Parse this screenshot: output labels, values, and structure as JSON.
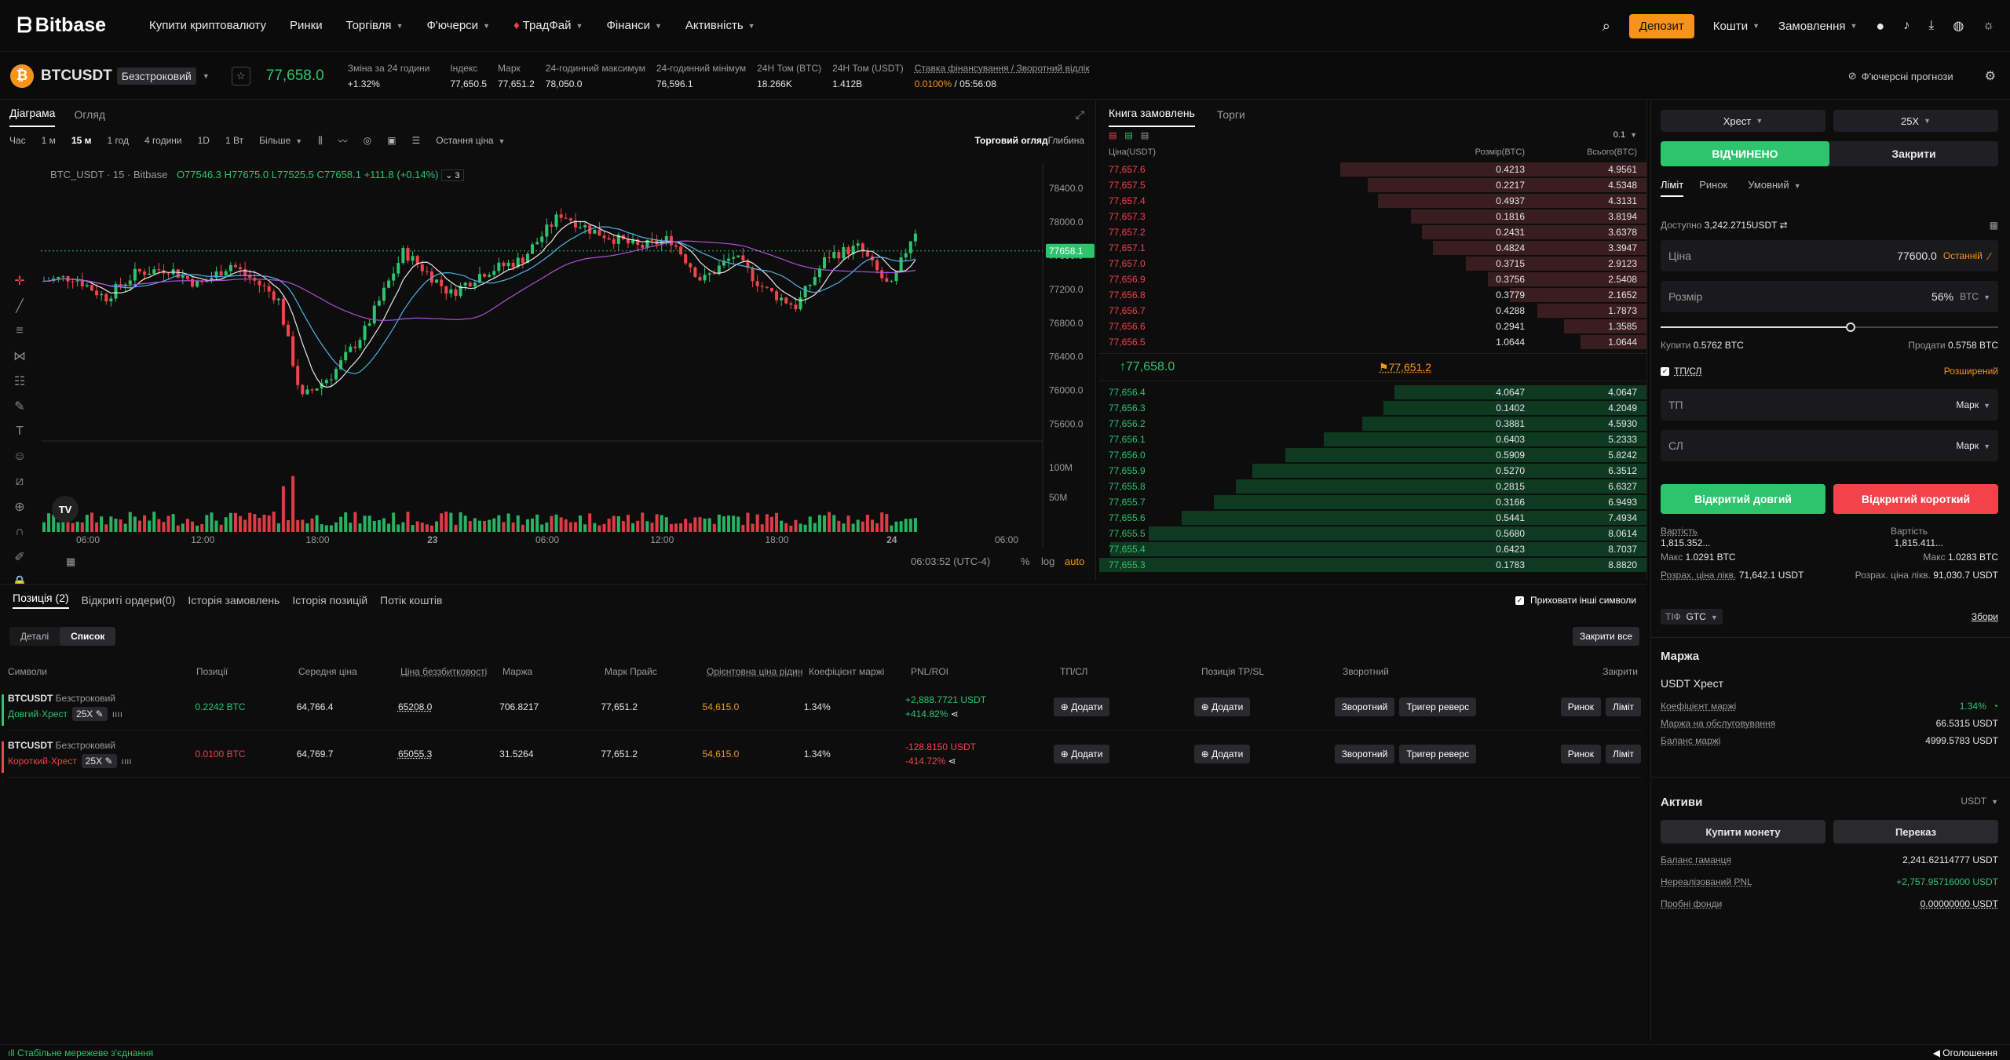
{
  "topnav": {
    "logo": "Bitbase",
    "items": [
      "Купити криптовалюту",
      "Ринки",
      "Торгівля",
      "Ф'ючерси",
      "ТрадФай",
      "Фінанси",
      "Активність"
    ],
    "deposit": "Депозит",
    "wallet": "Кошти",
    "orders": "Замовлення"
  },
  "ticker": {
    "symbol": "BTCUSDT",
    "type": "Безстроковий",
    "last_price": "77,658.0",
    "stats": [
      {
        "k": "Зміна за 24 години",
        "v": "+1.32%"
      },
      {
        "k": "Індекс",
        "v": "77,650.5"
      },
      {
        "k": "Марк",
        "v": "77,651.2"
      },
      {
        "k": "24-годинний максимум",
        "v": "78,050.0"
      },
      {
        "k": "24-годинний мінімум",
        "v": "76,596.1"
      },
      {
        "k": "24H Том (BTC)",
        "v": "18.266K"
      },
      {
        "k": "24H Том (USDT)",
        "v": "1.412B"
      }
    ],
    "funding_label": "Ставка фінансування / Зворотний відлік",
    "funding_rate": "0.0100%",
    "countdown": "05:56:08",
    "forecast": "Ф'ючерсні прогнози"
  },
  "chart_tabs": {
    "chart": "Діаграма",
    "overview": "Огляд"
  },
  "chart_toolbar": {
    "intervals": [
      "Час",
      "1 м",
      "15 м",
      "1 год",
      "4 години",
      "1D",
      "1 Вт",
      "Більше"
    ],
    "active": "15 м",
    "last_price": "Остання ціна",
    "trading_view": "Торговий огляд",
    "depth": "Глибина"
  },
  "chart_legend": {
    "title": "BTC_USDT · 15 · Bitbase",
    "o": "O77546.3",
    "h": "H77675.0",
    "l": "L77525.5",
    "c": "C77658.1",
    "chg": "+111.8 (+0.14%)",
    "indicators": "3"
  },
  "chart_data": {
    "type": "candlestick",
    "x_ticks": [
      "06:00",
      "12:00",
      "18:00",
      "23",
      "06:00",
      "12:00",
      "18:00",
      "24",
      "06:00"
    ],
    "y_ticks": [
      78400,
      78000,
      77600,
      77200,
      76800,
      76400,
      76000,
      75600
    ],
    "ylim": [
      75400,
      78700
    ],
    "last_label": "77658.1",
    "volume_ticks": [
      "100M",
      "50M"
    ]
  },
  "chart_footer": {
    "time": "06:03:52 (UTC-4)",
    "pct": "%",
    "log": "log",
    "auto": "auto"
  },
  "book": {
    "tabs": [
      "Книга замовлень",
      "Торги"
    ],
    "step": "0.1",
    "headers": [
      "Ціна(USDT)",
      "Розмір(BTC)",
      "Всього(BTC)"
    ],
    "asks": [
      [
        "77,657.6",
        "0.4213",
        "4.9561",
        0.56
      ],
      [
        "77,657.5",
        "0.2217",
        "4.5348",
        0.51
      ],
      [
        "77,657.4",
        "0.4937",
        "4.3131",
        0.49
      ],
      [
        "77,657.3",
        "0.1816",
        "3.8194",
        0.43
      ],
      [
        "77,657.2",
        "0.2431",
        "3.6378",
        0.41
      ],
      [
        "77,657.1",
        "0.4824",
        "3.3947",
        0.39
      ],
      [
        "77,657.0",
        "0.3715",
        "2.9123",
        0.33
      ],
      [
        "77,656.9",
        "0.3756",
        "2.5408",
        0.29
      ],
      [
        "77,656.8",
        "0.3779",
        "2.1652",
        0.25
      ],
      [
        "77,656.7",
        "0.4288",
        "1.7873",
        0.2
      ],
      [
        "77,656.6",
        "0.2941",
        "1.3585",
        0.15
      ],
      [
        "77,656.5",
        "1.0644",
        "1.0644",
        0.12
      ]
    ],
    "mid_price": "↑77,658.0",
    "mark_price": "77,651.2",
    "bids": [
      [
        "77,656.4",
        "4.0647",
        "4.0647",
        0.46
      ],
      [
        "77,656.3",
        "0.1402",
        "4.2049",
        0.48
      ],
      [
        "77,656.2",
        "0.3881",
        "4.5930",
        0.52
      ],
      [
        "77,656.1",
        "0.6403",
        "5.2333",
        0.59
      ],
      [
        "77,656.0",
        "0.5909",
        "5.8242",
        0.66
      ],
      [
        "77,655.9",
        "0.5270",
        "6.3512",
        0.72
      ],
      [
        "77,655.8",
        "0.2815",
        "6.6327",
        0.75
      ],
      [
        "77,655.7",
        "0.3166",
        "6.9493",
        0.79
      ],
      [
        "77,655.6",
        "0.5441",
        "7.4934",
        0.85
      ],
      [
        "77,655.5",
        "0.5680",
        "8.0614",
        0.91
      ],
      [
        "77,655.4",
        "0.6423",
        "8.7037",
        0.98
      ],
      [
        "77,655.3",
        "0.1783",
        "8.8820",
        1.0
      ]
    ]
  },
  "order": {
    "margin_mode": "Хрест",
    "leverage": "25X",
    "open": "ВІДЧИНЕНО",
    "close": "Закрити",
    "types": [
      "Ліміт",
      "Ринок",
      "Умовний"
    ],
    "available_label": "Доступно",
    "available": "3,242.2715USDT",
    "price_label": "Ціна",
    "price": "77600.0",
    "last_btn": "Останній",
    "size_label": "Розмір",
    "size_pct": "56%",
    "size_unit": "BTC",
    "buy_label": "Купити",
    "buy_amt": "0.5762 BTC",
    "sell_label": "Продати",
    "sell_amt": "0.5758 BTC",
    "tpsl": "ТП/СЛ",
    "advanced": "Розширений",
    "tp": "ТП",
    "sl": "СЛ",
    "mark": "Марк",
    "long_btn": "Відкритий довгий",
    "short_btn": "Відкритий короткий",
    "cost_label": "Вартість",
    "cost_l": "1,815.352...",
    "cost_r": "1,815.411...",
    "max_label": "Макс",
    "max_l": "1.0291 BTC",
    "max_r": "1.0283 BTC",
    "liq_label": "Розрах. ціна лікв.",
    "liq_l": "71,642.1 USDT",
    "liq_r": "91,030.7 USDT",
    "tif": "ТІФ",
    "gtc": "GTC",
    "fees": "Збори"
  },
  "margin": {
    "title": "Маржа",
    "mode": "USDT Хрест",
    "ratio_label": "Коефіцієнт маржі",
    "ratio": "1.34%",
    "maint_label": "Маржа на обслуговування",
    "maint": "66.5315 USDT",
    "balance_label": "Баланс маржі",
    "balance": "4999.5783 USDT"
  },
  "assets": {
    "title": "Активи",
    "unit": "USDT",
    "buy_coin": "Купити монету",
    "transfer": "Переказ",
    "wallet_label": "Баланс гаманця",
    "wallet": "2,241.62114777 USDT",
    "upnl_label": "Нереалізований PNL",
    "upnl": "+2,757.95716000 USDT",
    "trial_label": "Пробні фонди",
    "trial": "0.00000000 USDT"
  },
  "positions": {
    "tabs": [
      "Позиція (2)",
      "Відкриті ордери(0)",
      "Історія замовлень",
      "Історія позицій",
      "Потік коштів"
    ],
    "hide_others": "Приховати інші символи",
    "view_details": "Деталі",
    "view_list": "Список",
    "close_all": "Закрити все",
    "headers": [
      "Символи",
      "Позиції",
      "Середня ціна",
      "Ціна беззбитковості",
      "Маржа",
      "Марк Прайс",
      "Орієнтовна ціна рідин",
      "Коефіцієнт маржі",
      "PNL/ROI",
      "ТП/СЛ",
      "Позиція TP/SL",
      "Зворотний",
      "Закрити"
    ],
    "add": "Додати",
    "reverse": "Зворотний",
    "trigger_reverse": "Тригер реверс",
    "market": "Ринок",
    "limit": "Ліміт",
    "rows": [
      {
        "sym": "BTCUSDT",
        "type": "Безстроковий",
        "side": "Довгий·Хрест",
        "lev": "25X",
        "qty": "0.2242 BTC",
        "avg": "64,766.4",
        "be": "65208.0",
        "margin": "706.8217",
        "mark": "77,651.2",
        "liq": "54,615.0",
        "ratio": "1.34%",
        "pnl": "+2,888.7721 USDT",
        "roi": "+414.82%"
      },
      {
        "sym": "BTCUSDT",
        "type": "Безстроковий",
        "side": "Короткий·Хрест",
        "lev": "25X",
        "qty": "0.0100 BTC",
        "avg": "64,769.7",
        "be": "65055.3",
        "margin": "31.5264",
        "mark": "77,651.2",
        "liq": "54,615.0",
        "ratio": "1.34%",
        "pnl": "-128.8150 USDT",
        "roi": "-414.72%"
      }
    ]
  },
  "status": {
    "conn": "Стабільне мережеве з'єднання",
    "announce": "Оголошення"
  }
}
